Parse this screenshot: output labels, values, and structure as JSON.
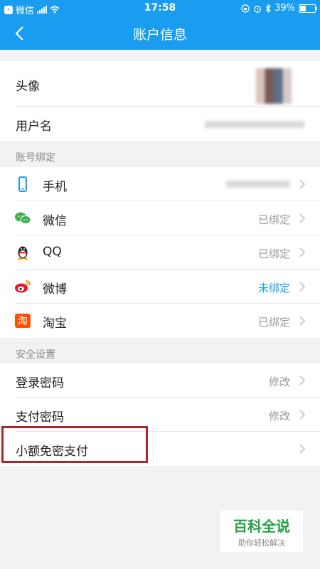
{
  "status_bar": {
    "carrier": "微信",
    "time": "17:58",
    "battery": "39%",
    "battery_level": 0.39
  },
  "nav": {
    "title": "账户信息",
    "back_icon": "chevron-left-icon"
  },
  "profile": {
    "avatar_label": "头像",
    "username_label": "用户名"
  },
  "bindings": {
    "section_title": "账号绑定",
    "items": [
      {
        "label": "手机",
        "value": "",
        "icon": "phone-icon"
      },
      {
        "label": "微信",
        "value": "已绑定",
        "icon": "wechat-icon"
      },
      {
        "label": "QQ",
        "value": "已绑定",
        "icon": "qq-icon"
      },
      {
        "label": "微博",
        "value": "未绑定",
        "icon": "weibo-icon"
      },
      {
        "label": "淘宝",
        "value": "已绑定",
        "icon": "taobao-icon"
      }
    ]
  },
  "security": {
    "section_title": "安全设置",
    "items": [
      {
        "label": "登录密码",
        "value": "修改"
      },
      {
        "label": "支付密码",
        "value": "修改"
      },
      {
        "label": "小额免密支付",
        "value": ""
      }
    ]
  },
  "watermark": {
    "title": "百科全说",
    "subtitle": "助你轻松解决"
  },
  "colors": {
    "accent": "#1a9cf0",
    "highlight": "#b0252a",
    "watermark_green": "#25a047"
  }
}
